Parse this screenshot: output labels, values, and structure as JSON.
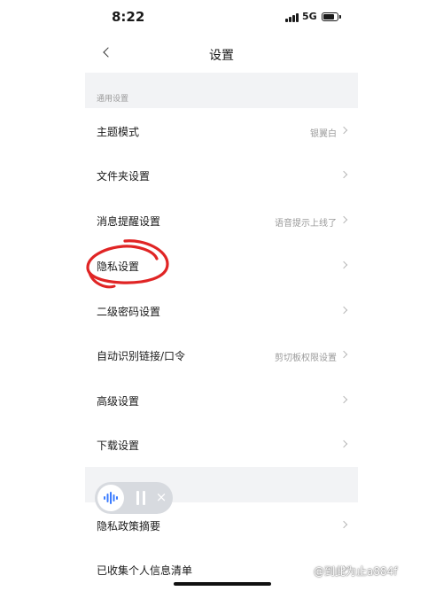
{
  "status": {
    "time": "8:22",
    "network": "5G",
    "battery_level": 0.8
  },
  "nav": {
    "title": "设置"
  },
  "sections": [
    {
      "label": "通用设置"
    },
    {
      "label": ""
    }
  ],
  "rows": [
    {
      "label": "主题模式",
      "value": "银翼白"
    },
    {
      "label": "文件夹设置",
      "value": ""
    },
    {
      "label": "消息提醒设置",
      "value": "语音提示上线了"
    },
    {
      "label": "隐私设置",
      "value": ""
    },
    {
      "label": "二级密码设置",
      "value": ""
    },
    {
      "label": "自动识别链接/口令",
      "value": "剪切板权限设置"
    },
    {
      "label": "高级设置",
      "value": ""
    },
    {
      "label": "下载设置",
      "value": ""
    },
    {
      "label": "隐私政策摘要",
      "value": ""
    },
    {
      "label": "已收集个人信息清单",
      "value": ""
    }
  ],
  "voice_control": {
    "close_glyph": "×"
  },
  "watermark": "@到此为止a884f",
  "colors": {
    "accent": "#3b7cff",
    "annotation": "#e02424",
    "section_bg": "#f2f3f5"
  }
}
